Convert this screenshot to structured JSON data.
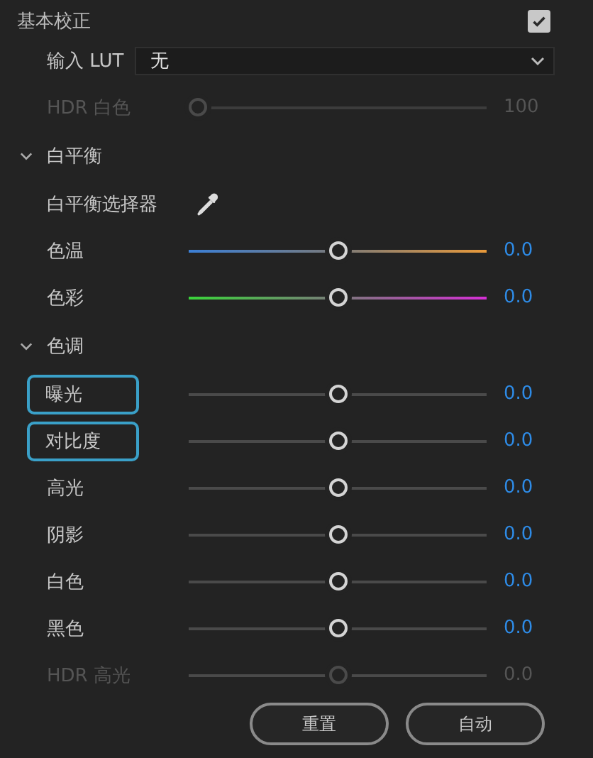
{
  "panel": {
    "title": "基本校正",
    "checked": true
  },
  "lut": {
    "label": "输入 LUT",
    "value": "无"
  },
  "hdr_white": {
    "label": "HDR 白色",
    "level": 0,
    "reading": "100",
    "disabled": true
  },
  "sections": [
    {
      "title": "白平衡",
      "expanded": true,
      "rows": [
        {
          "kind": "picker",
          "label": "白平衡选择器"
        },
        {
          "kind": "temperature-slider",
          "label": "色温",
          "level": 0.5,
          "reading": "0.0",
          "highlighted": false,
          "disabled": false
        },
        {
          "kind": "tint-slider",
          "label": "色彩",
          "level": 0.5,
          "reading": "0.0",
          "highlighted": false,
          "disabled": false
        }
      ]
    },
    {
      "title": "色调",
      "expanded": true,
      "rows": [
        {
          "kind": "slider",
          "label": "曝光",
          "level": 0.5,
          "reading": "0.0",
          "highlighted": true,
          "disabled": false
        },
        {
          "kind": "slider",
          "label": "对比度",
          "level": 0.5,
          "reading": "0.0",
          "highlighted": true,
          "disabled": false
        },
        {
          "kind": "slider",
          "label": "高光",
          "level": 0.5,
          "reading": "0.0",
          "highlighted": false,
          "disabled": false
        },
        {
          "kind": "slider",
          "label": "阴影",
          "level": 0.5,
          "reading": "0.0",
          "highlighted": false,
          "disabled": false
        },
        {
          "kind": "slider",
          "label": "白色",
          "level": 0.5,
          "reading": "0.0",
          "highlighted": false,
          "disabled": false
        },
        {
          "kind": "slider",
          "label": "黑色",
          "level": 0.5,
          "reading": "0.0",
          "highlighted": false,
          "disabled": false
        },
        {
          "kind": "slider",
          "label": "HDR 高光",
          "level": 0.5,
          "reading": "0.0",
          "highlighted": false,
          "disabled": true
        }
      ]
    }
  ],
  "buttons": [
    "重置",
    "自动"
  ]
}
